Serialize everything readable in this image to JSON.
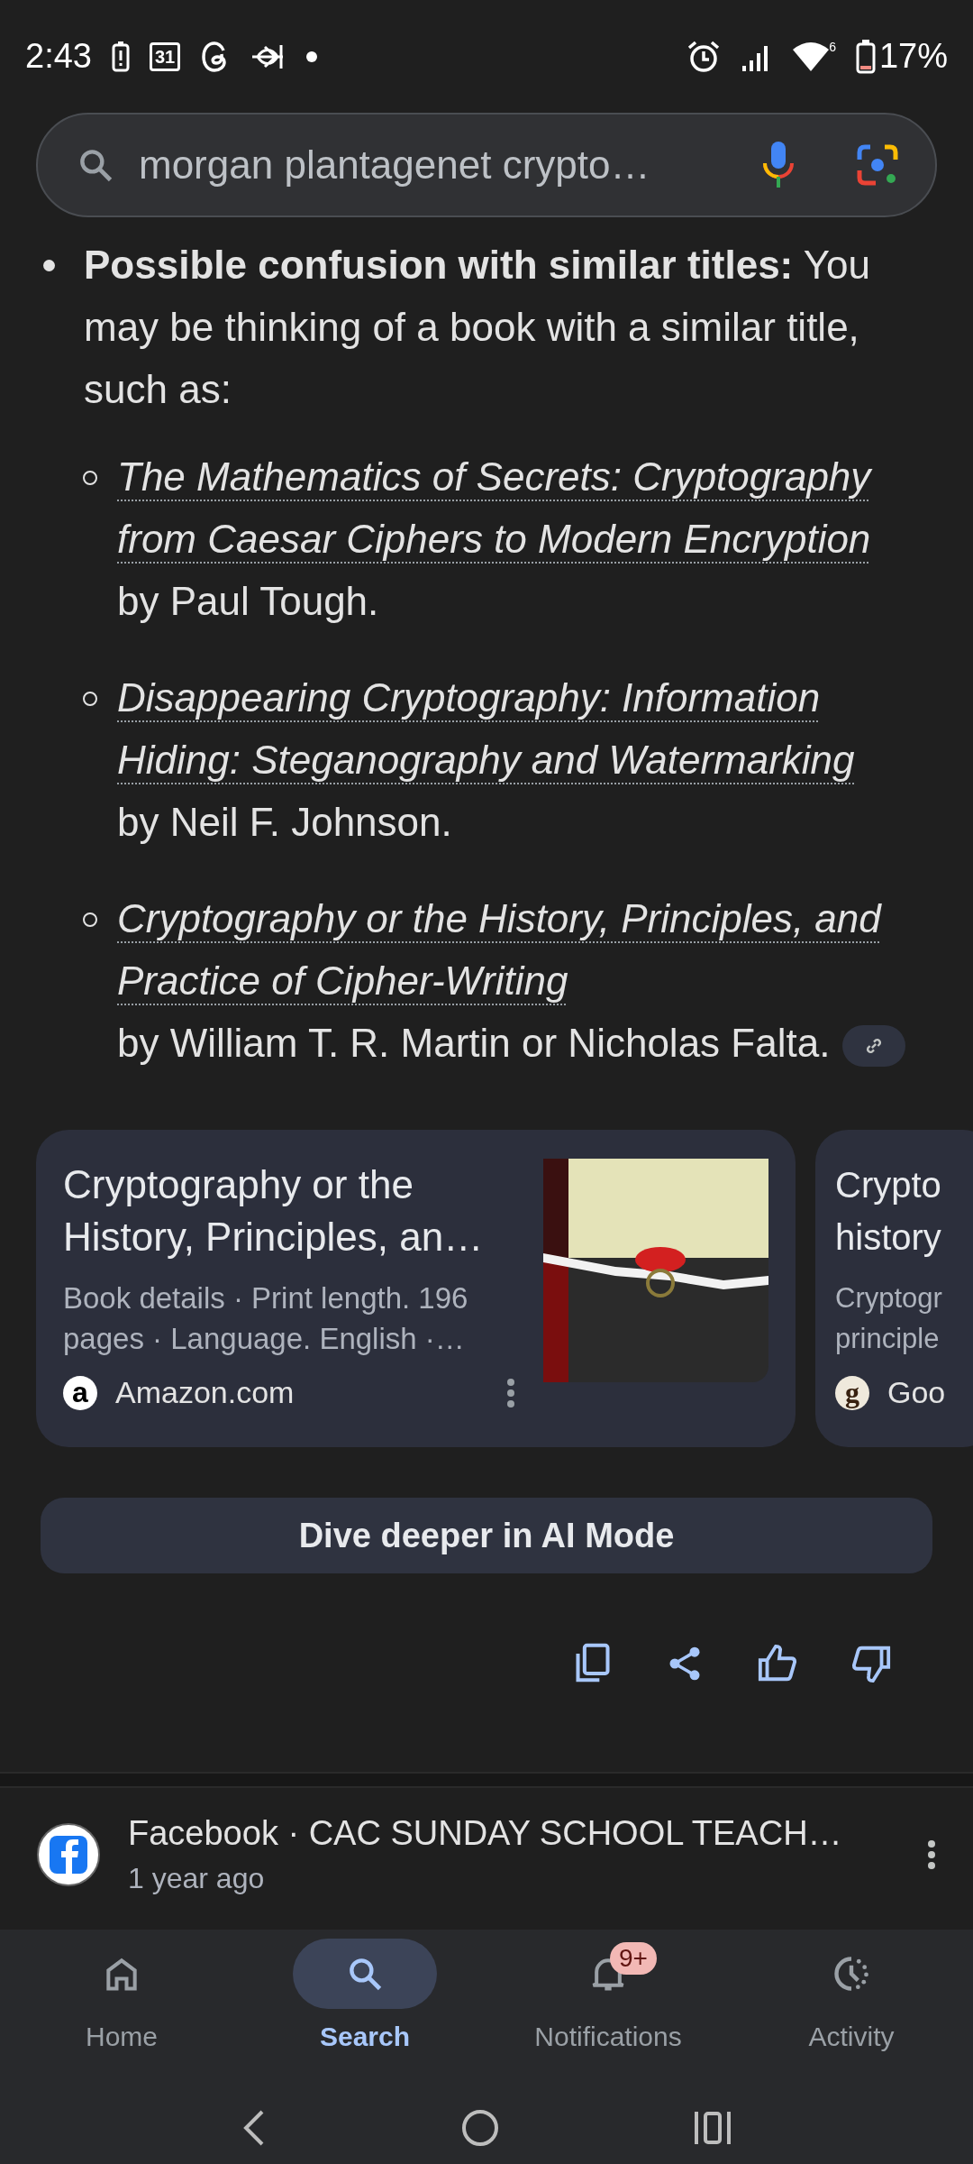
{
  "status_bar": {
    "time": "2:43",
    "calendar_day": "31",
    "battery": "17%",
    "wifi_generation": "6"
  },
  "search": {
    "value": "morgan plantagenet crypto…"
  },
  "answer": {
    "lead": "Possible confusion with similar titles:",
    "text": " You may be thinking of a book with a similar title, such as:",
    "items": [
      {
        "title": "The Mathematics of Secrets: Cryptography from Caesar Ciphers to Modern Encryption",
        "text": "by Paul Tough.",
        "source_chip": false
      },
      {
        "title": "Disappearing Cryptography: Information Hiding: Steganography and Watermarking",
        "text": "by Neil F. Johnson.",
        "source_chip": false
      },
      {
        "title": "Cryptography or the History, Principles, and Practice of Cipher-Writing",
        "text": "by William T. R. Martin or Nicholas Falta.",
        "source_chip": true
      }
    ]
  },
  "cards": [
    {
      "title": "Cryptography or the History, Principles, an…",
      "description": "Book details · Print length. 196 pages · Language. English ·…",
      "source": "Amazon.com",
      "logo": "a",
      "image": true
    },
    {
      "title": "Crypto history",
      "description": "Cryptogr principle",
      "source": "Goo",
      "logo": "g",
      "image": false
    }
  ],
  "dive_button": "Dive deeper in AI Mode",
  "result": {
    "site": "Facebook · CAC SUNDAY SCHOOL TEACH…",
    "age": "1 year ago"
  },
  "nav": [
    {
      "label": "Home",
      "selected": false
    },
    {
      "label": "Search",
      "selected": true
    },
    {
      "label": "Notifications",
      "selected": false,
      "badge": "9+"
    },
    {
      "label": "Activity",
      "selected": false
    }
  ]
}
